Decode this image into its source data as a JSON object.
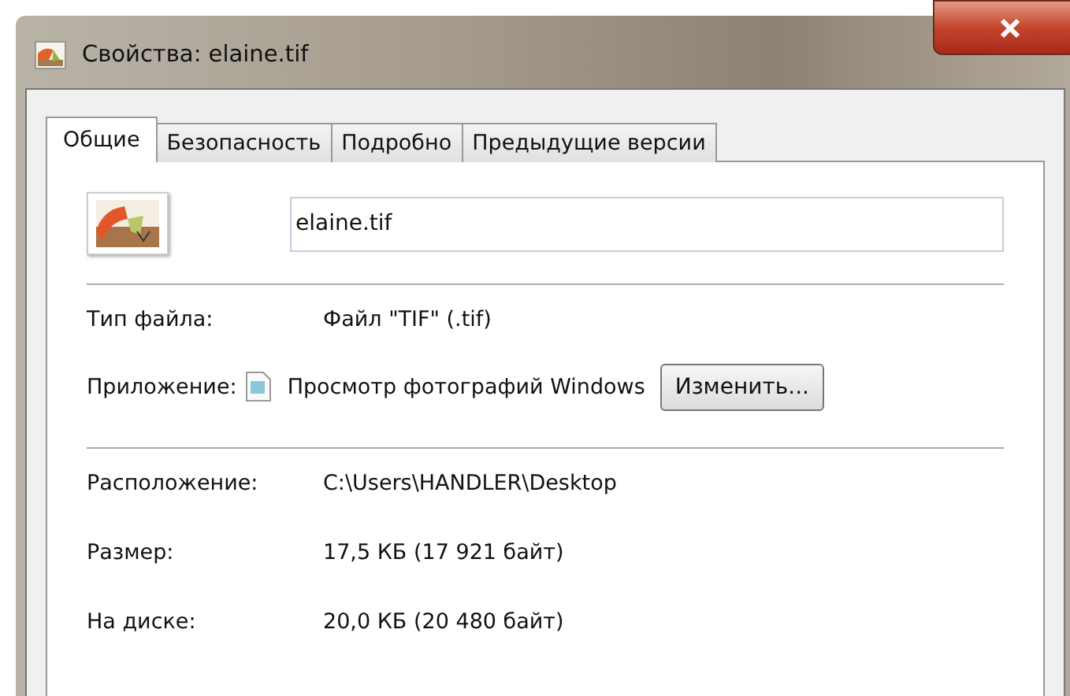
{
  "window": {
    "title": "Свойства: elaine.tif"
  },
  "tabs": [
    {
      "label": "Общие",
      "selected": true
    },
    {
      "label": "Безопасность",
      "selected": false
    },
    {
      "label": "Подробно",
      "selected": false
    },
    {
      "label": "Предыдущие версии",
      "selected": false
    }
  ],
  "file_name": {
    "value": "elaine.tif"
  },
  "type_row": {
    "label": "Тип файла:",
    "value": "Файл \"TIF\" (.tif)"
  },
  "app_row": {
    "label": "Приложение:",
    "value": "Просмотр фотографий Windows",
    "button": "Изменить..."
  },
  "details": [
    {
      "label": "Расположение:",
      "value": "C:\\Users\\HANDLER\\Desktop"
    },
    {
      "label": "Размер:",
      "value": "17,5 КБ (17 921 байт)"
    },
    {
      "label": "На диске:",
      "value": "20,0 КБ (20 480 байт)"
    }
  ]
}
